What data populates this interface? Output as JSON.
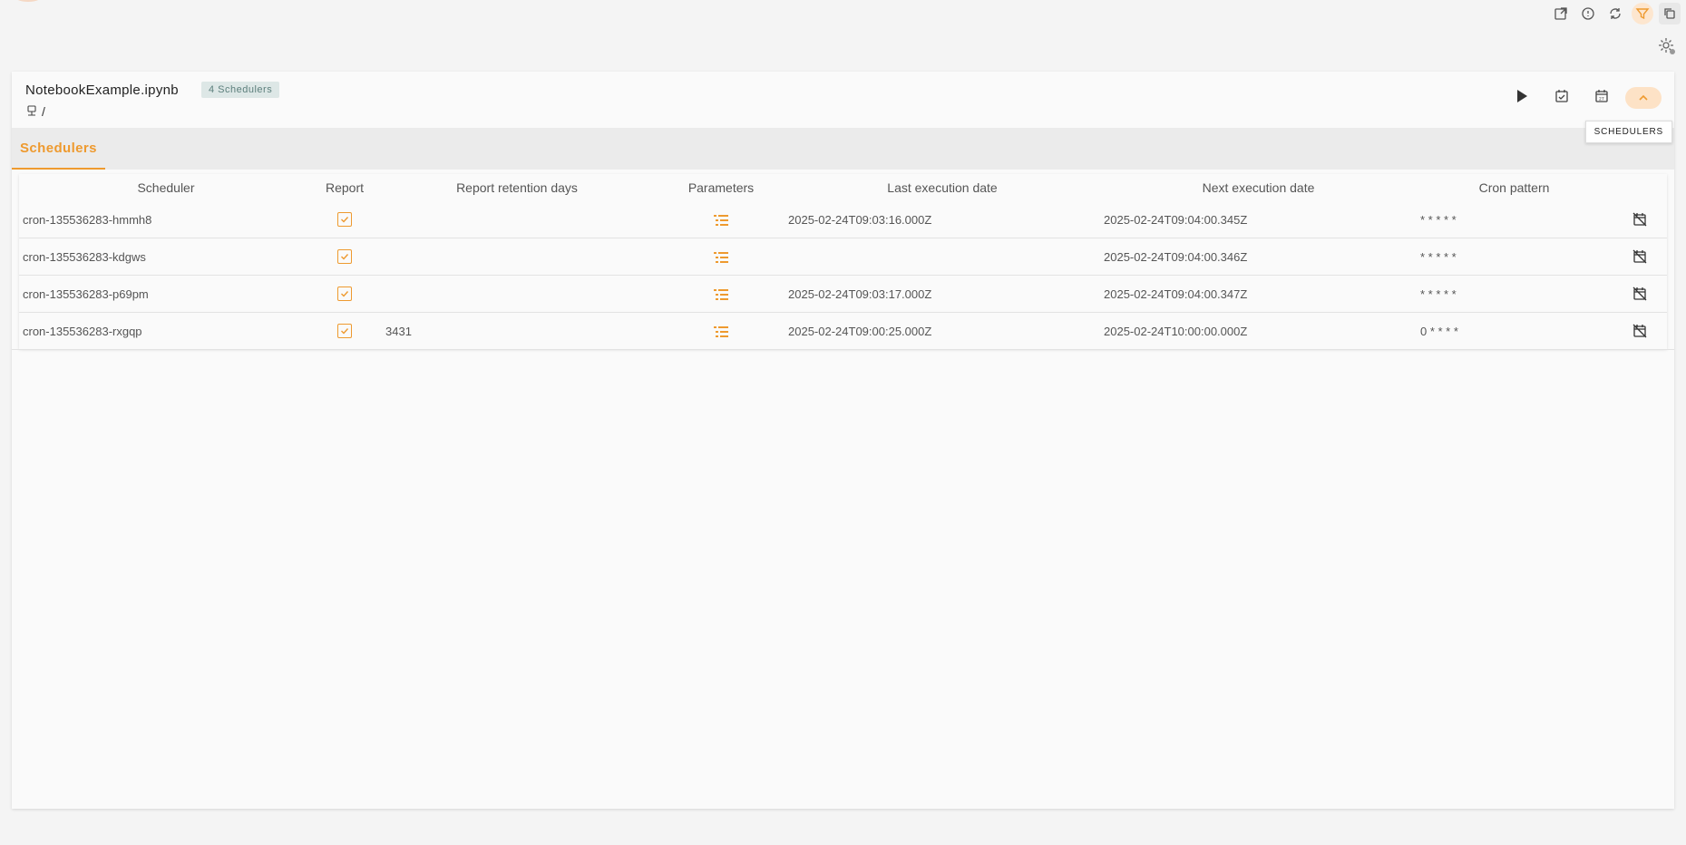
{
  "notebook": {
    "title": "NotebookExample.ipynb",
    "badge": "4 Schedulers",
    "path": "/"
  },
  "header_icons": [
    "play-icon",
    "history-icon",
    "calendar-icon",
    "chevron-up-icon"
  ],
  "tooltip": "SCHEDULERS",
  "tabs": [
    {
      "label": "Schedulers"
    }
  ],
  "table": {
    "columns": [
      "Scheduler",
      "Report",
      "Report retention days",
      "Parameters",
      "Last execution date",
      "Next execution date",
      "Cron pattern",
      ""
    ],
    "rows": [
      {
        "name": "cron-135536283-hmmh8",
        "report": true,
        "retention": "",
        "last": "2025-02-24T09:03:16.000Z",
        "next": "2025-02-24T09:04:00.345Z",
        "cron": "* * * * *"
      },
      {
        "name": "cron-135536283-kdgws",
        "report": true,
        "retention": "",
        "last": "",
        "next": "2025-02-24T09:04:00.346Z",
        "cron": "* * * * *"
      },
      {
        "name": "cron-135536283-p69pm",
        "report": true,
        "retention": "",
        "last": "2025-02-24T09:03:17.000Z",
        "next": "2025-02-24T09:04:00.347Z",
        "cron": "* * * * *"
      },
      {
        "name": "cron-135536283-rxgqp",
        "report": true,
        "retention": "3431",
        "last": "2025-02-24T09:00:25.000Z",
        "next": "2025-02-24T10:00:00.000Z",
        "cron": "0 * * * *"
      }
    ]
  },
  "colors": {
    "accent": "#ee9a2f",
    "badge_bg": "#dde7e6",
    "badge_text": "#5c7f7c"
  }
}
